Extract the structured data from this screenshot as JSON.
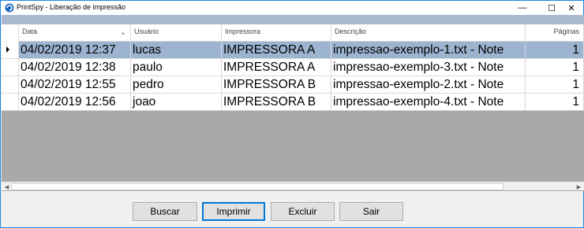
{
  "window": {
    "title": "PrintSpy - Liberação de impressão",
    "controls": {
      "minimize": "—",
      "maximize": "☐",
      "close": "✕"
    }
  },
  "grid": {
    "columns": [
      {
        "label": "Data"
      },
      {
        "label": "Usuário"
      },
      {
        "label": "Impressora"
      },
      {
        "label": "Descrição"
      },
      {
        "label": "Páginas"
      }
    ],
    "rows": [
      {
        "data": "04/02/2019 12:37",
        "usuario": "lucas",
        "impressora": "IMPRESSORA A",
        "descricao": "impressao-exemplo-1.txt - Note",
        "paginas": "1"
      },
      {
        "data": "04/02/2019 12:38",
        "usuario": "paulo",
        "impressora": "IMPRESSORA A",
        "descricao": "impressao-exemplo-3.txt - Note",
        "paginas": "1"
      },
      {
        "data": "04/02/2019 12:55",
        "usuario": "pedro",
        "impressora": "IMPRESSORA B",
        "descricao": "impressao-exemplo-2.txt - Note",
        "paginas": "1"
      },
      {
        "data": "04/02/2019 12:56",
        "usuario": "joao",
        "impressora": "IMPRESSORA B",
        "descricao": "impressao-exemplo-4.txt - Note",
        "paginas": "1"
      }
    ],
    "selected_row": 0,
    "colors": {
      "selected": "#9db4d1",
      "empty_area": "#a9a9a9"
    }
  },
  "buttons": {
    "buscar": "Buscar",
    "imprimir": "Imprimir",
    "excluir": "Excluir",
    "sair": "Sair"
  }
}
